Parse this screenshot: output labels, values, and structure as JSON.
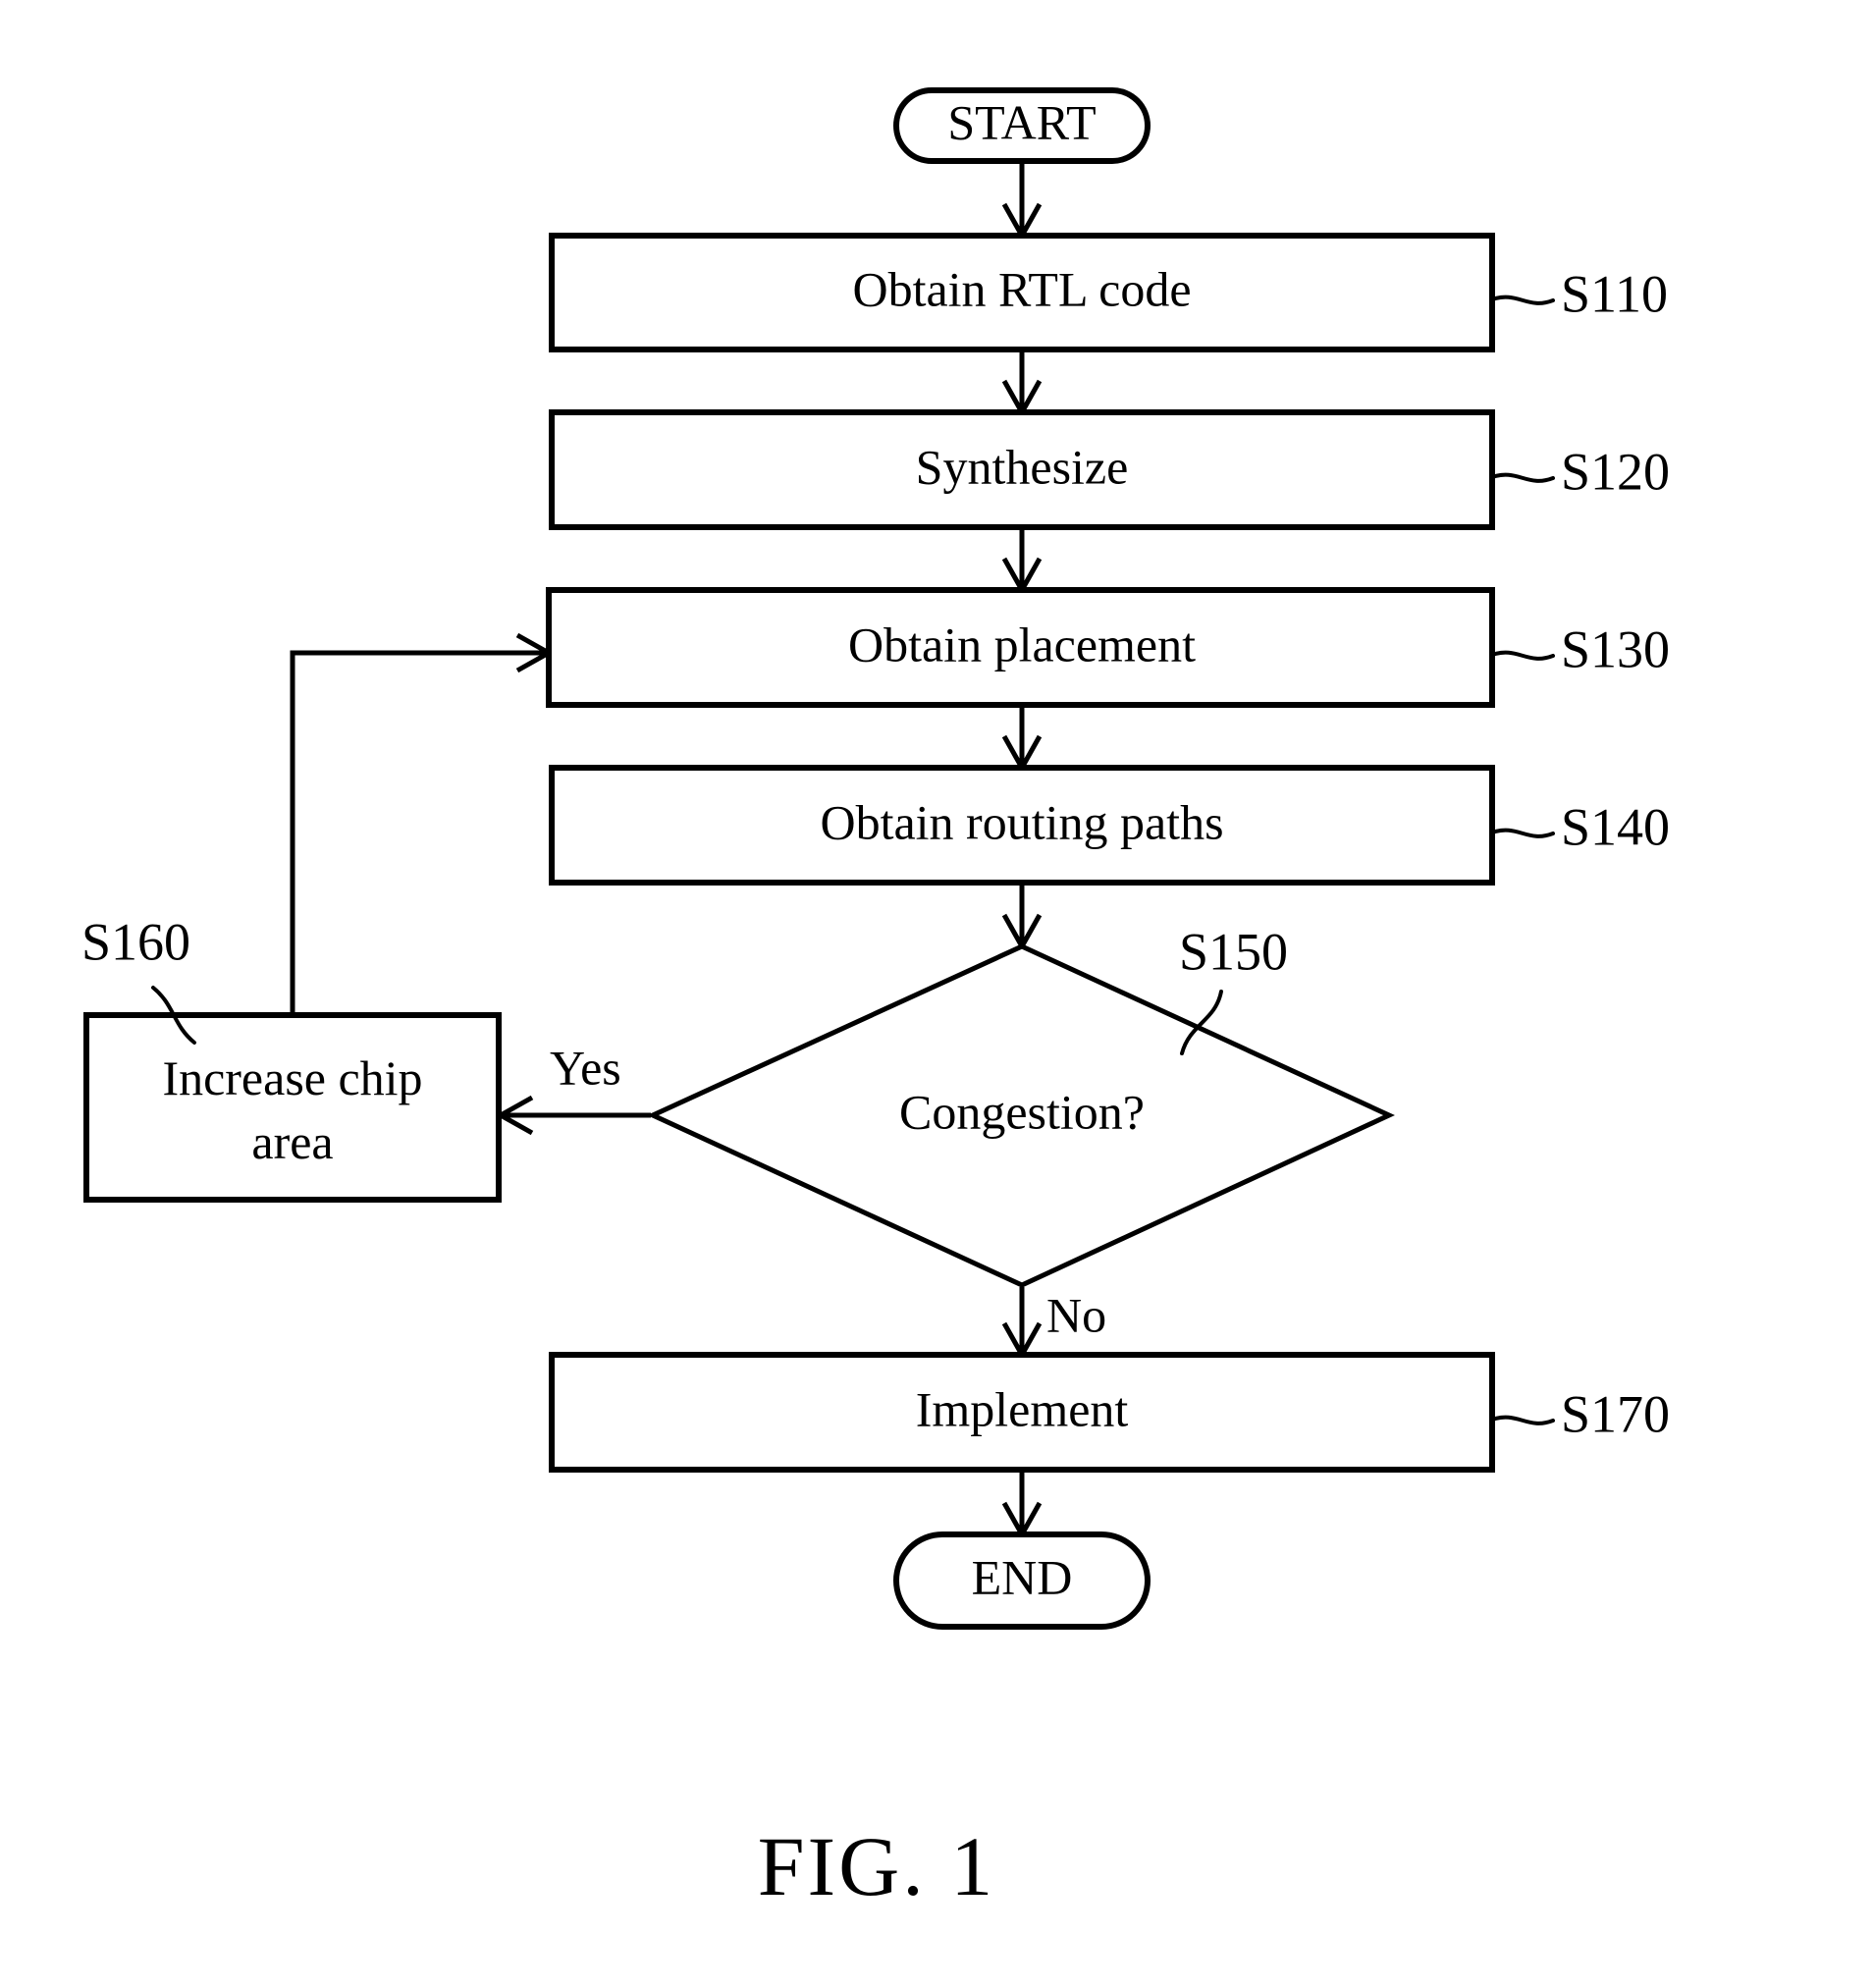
{
  "figure": {
    "caption": "FIG. 1",
    "type": "flowchart"
  },
  "nodes": {
    "start": {
      "label": "START",
      "shape": "stadium"
    },
    "s110": {
      "label": "Obtain RTL code",
      "shape": "process",
      "ref": "S110"
    },
    "s120": {
      "label": "Synthesize",
      "shape": "process",
      "ref": "S120"
    },
    "s130": {
      "label": "Obtain placement",
      "shape": "process",
      "ref": "S130"
    },
    "s140": {
      "label": "Obtain routing paths",
      "shape": "process",
      "ref": "S140"
    },
    "s150": {
      "label": "Congestion?",
      "shape": "decision",
      "ref": "S150"
    },
    "s160": {
      "label_line1": "Increase chip",
      "label_line2": "area",
      "shape": "process",
      "ref": "S160"
    },
    "s170": {
      "label": "Implement",
      "shape": "process",
      "ref": "S170"
    },
    "end": {
      "label": "END",
      "shape": "stadium"
    }
  },
  "edge_labels": {
    "yes": "Yes",
    "no": "No"
  },
  "chart_data": {
    "type": "diagram",
    "title": "FIG. 1",
    "nodes": [
      {
        "id": "START",
        "text": "START",
        "kind": "terminator"
      },
      {
        "id": "S110",
        "text": "Obtain RTL code",
        "kind": "process"
      },
      {
        "id": "S120",
        "text": "Synthesize",
        "kind": "process"
      },
      {
        "id": "S130",
        "text": "Obtain placement",
        "kind": "process"
      },
      {
        "id": "S140",
        "text": "Obtain routing paths",
        "kind": "process"
      },
      {
        "id": "S150",
        "text": "Congestion?",
        "kind": "decision"
      },
      {
        "id": "S160",
        "text": "Increase chip area",
        "kind": "process"
      },
      {
        "id": "S170",
        "text": "Implement",
        "kind": "process"
      },
      {
        "id": "END",
        "text": "END",
        "kind": "terminator"
      }
    ],
    "edges": [
      {
        "from": "START",
        "to": "S110",
        "label": ""
      },
      {
        "from": "S110",
        "to": "S120",
        "label": ""
      },
      {
        "from": "S120",
        "to": "S130",
        "label": ""
      },
      {
        "from": "S130",
        "to": "S140",
        "label": ""
      },
      {
        "from": "S140",
        "to": "S150",
        "label": ""
      },
      {
        "from": "S150",
        "to": "S160",
        "label": "Yes"
      },
      {
        "from": "S150",
        "to": "S170",
        "label": "No"
      },
      {
        "from": "S160",
        "to": "S130",
        "label": ""
      },
      {
        "from": "S170",
        "to": "END",
        "label": ""
      }
    ]
  }
}
